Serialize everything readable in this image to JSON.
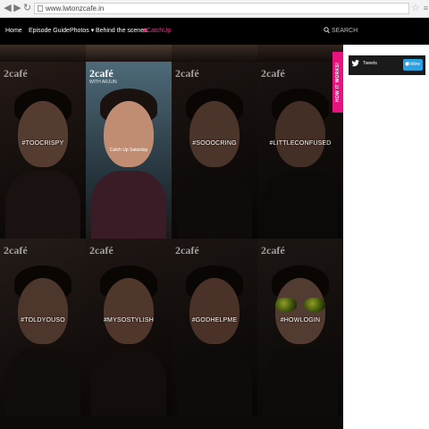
{
  "browser": {
    "url": "www.lwtonzcafe.in"
  },
  "nav": {
    "items": [
      "Home",
      "Episode Guide",
      "Photos",
      "Behind the scenes",
      "#CatchUp"
    ],
    "search_placeholder": "SEARCH"
  },
  "tiles": [
    {
      "logo": "2café",
      "tag": "#TOOCRISPY",
      "style": "dark"
    },
    {
      "logo": "2café",
      "sub": "WITH ARJUN",
      "caption": "Catch Up Saturday",
      "tag": "",
      "style": "bright"
    },
    {
      "logo": "2café",
      "tag": "#SOOOCRING",
      "style": "dark"
    },
    {
      "logo": "2café",
      "tag": "#LITTLECONFUSED",
      "style": "dark"
    },
    {
      "logo": "2café",
      "tag": "#TOLDYOUSO",
      "style": "dark"
    },
    {
      "logo": "2café",
      "tag": "#MYSOSTYLISH",
      "style": "dark"
    },
    {
      "logo": "2café",
      "tag": "#GODHELPME",
      "style": "dark"
    },
    {
      "logo": "2café",
      "tag": "#HOWLOGIN",
      "style": "dark"
    }
  ],
  "sidebar": {
    "vertical_tab": "HOW IT WORKS!",
    "twitter": {
      "label": "Tweets",
      "follow": "Follow"
    }
  },
  "colors": {
    "accent": "#ff2d8a",
    "tab": "#e8137e",
    "twitter": "#2aa1e0"
  }
}
